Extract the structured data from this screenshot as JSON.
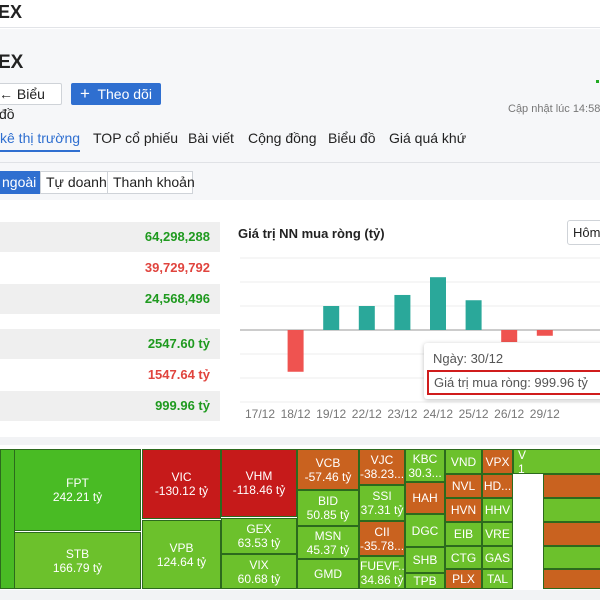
{
  "top_title": "EX",
  "header": {
    "title": "EX",
    "chart_button": "Biểu đồ",
    "follow_button": "Theo dõi",
    "updated": "Cập nhật lúc  14:58"
  },
  "tabs": [
    "kê thị trường",
    "TOP cổ phiếu",
    "Bài viết",
    "Cộng đồng",
    "Biểu đồ",
    "Giá quá khứ"
  ],
  "subtabs": [
    "ngoài",
    "Tự doanh",
    "Thanh khoản"
  ],
  "stats": [
    "64,298,288",
    "39,729,792",
    "24,568,496",
    "2547.60 tỷ",
    "1547.64 tỷ",
    "999.96 tỷ"
  ],
  "colors": {
    "up": "#1f9a1f",
    "down": "#e0443e",
    "bar_up": "#2aa89a",
    "bar_down": "#ef5350",
    "accent": "#2f6fd0"
  },
  "chart_data": {
    "type": "bar",
    "title": "Giá trị NN mua ròng (tỷ)",
    "range_select": "Hôm",
    "categories": [
      "17/12",
      "18/12",
      "19/12",
      "22/12",
      "23/12",
      "24/12",
      "25/12",
      "26/12",
      "29/12"
    ],
    "values": [
      0,
      -870,
      500,
      500,
      730,
      1100,
      620,
      -250,
      -120
    ],
    "ylim": [
      -1500,
      1500
    ],
    "tooltip": {
      "date": "Ngày: 30/12",
      "value": "Giá trị mua ròng: 999.96 tỷ"
    }
  },
  "treemap": [
    {
      "s": "FPT",
      "v": "242.21 tỷ"
    },
    {
      "s": "STB",
      "v": "166.79 tỷ"
    },
    {
      "s": "VIC",
      "v": "-130.12 tỷ"
    },
    {
      "s": "VPB",
      "v": "124.64 tỷ"
    },
    {
      "s": "VHM",
      "v": "-118.46 tỷ"
    },
    {
      "s": "GEX",
      "v": "63.53 tỷ"
    },
    {
      "s": "VIX",
      "v": "60.68 tỷ"
    },
    {
      "s": "VCB",
      "v": "-57.46 tỷ"
    },
    {
      "s": "BID",
      "v": "50.85 tỷ"
    },
    {
      "s": "MSN",
      "v": "45.37 tỷ"
    },
    {
      "s": "GMD",
      "v": ""
    },
    {
      "s": "VJC",
      "v": "-38.23..."
    },
    {
      "s": "SSI",
      "v": "37.31 tỷ"
    },
    {
      "s": "CII",
      "v": "-35.78..."
    },
    {
      "s": "FUEVF...",
      "v": "34.86 tỷ"
    },
    {
      "s": "KBC",
      "v": "30.3..."
    },
    {
      "s": "HAH",
      "v": ""
    },
    {
      "s": "DGC",
      "v": ""
    },
    {
      "s": "SHB",
      "v": ""
    },
    {
      "s": "TPB",
      "v": ""
    },
    {
      "s": "VND"
    },
    {
      "s": "NVL"
    },
    {
      "s": "HVN"
    },
    {
      "s": "EIB"
    },
    {
      "s": "CTG"
    },
    {
      "s": "PLX"
    },
    {
      "s": "VPX"
    },
    {
      "s": "HD..."
    },
    {
      "s": "HHV"
    },
    {
      "s": "VRE"
    },
    {
      "s": "GAS"
    },
    {
      "s": "TAL"
    },
    {
      "s": "V",
      "v": "1"
    }
  ]
}
